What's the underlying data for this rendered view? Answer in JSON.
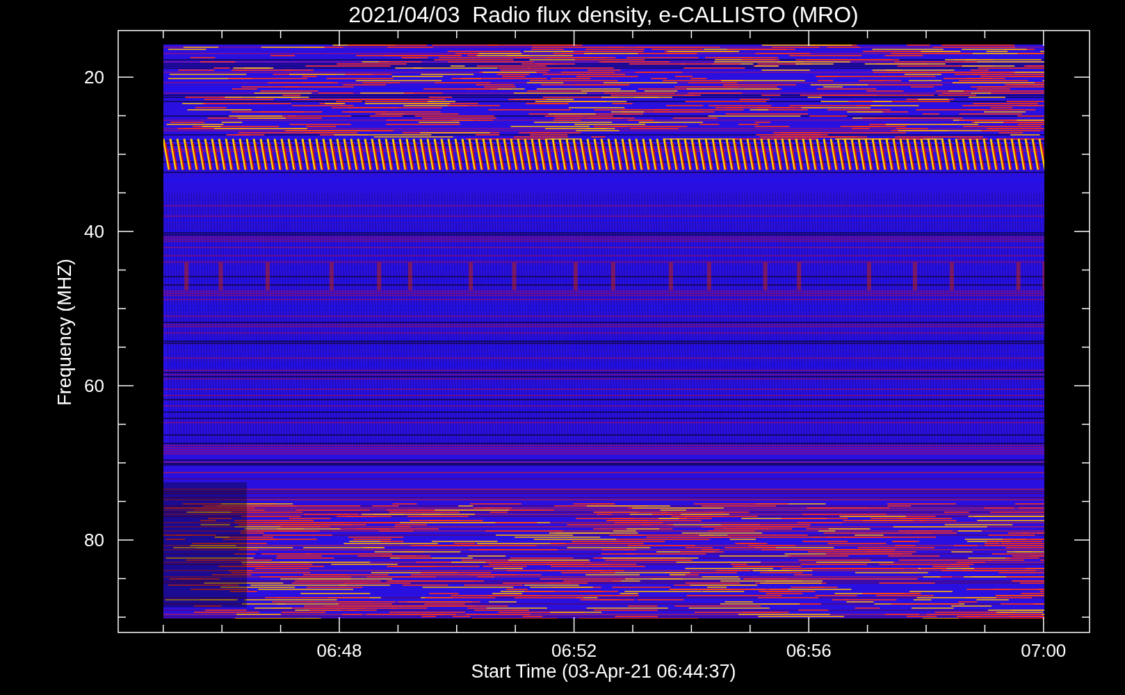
{
  "title": "2021/04/03  Radio flux density, e-CALLISTO (MRO)",
  "y_axis": {
    "label": "Frequency (MHZ)",
    "ticks": [
      "20",
      "40",
      "60",
      "80"
    ]
  },
  "x_axis": {
    "label": "Start Time (03-Apr-21 06:44:37)",
    "ticks": [
      "06:48",
      "06:52",
      "06:56",
      "07:00"
    ]
  }
}
